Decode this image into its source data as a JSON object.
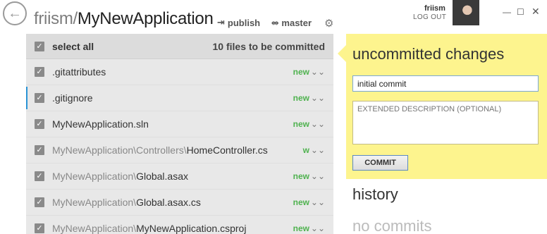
{
  "header": {
    "owner": "friism",
    "separator": "/",
    "repo": "MyNewApplication",
    "publish_label": "publish",
    "branch_label": "master",
    "user_name": "friism",
    "logout_label": "LOG OUT"
  },
  "file_list": {
    "select_all_label": "select all",
    "count_label": "10 files to be committed",
    "files": [
      {
        "dir": "",
        "name": ".gitattributes",
        "status": "new"
      },
      {
        "dir": "",
        "name": ".gitignore",
        "status": "new"
      },
      {
        "dir": "",
        "name": "MyNewApplication.sln",
        "status": "new"
      },
      {
        "dir": "MyNewApplication\\Controllers\\",
        "name": "HomeController.cs",
        "status": "w"
      },
      {
        "dir": "MyNewApplication\\",
        "name": "Global.asax",
        "status": "new"
      },
      {
        "dir": "MyNewApplication\\",
        "name": "Global.asax.cs",
        "status": "new"
      },
      {
        "dir": "MyNewApplication\\",
        "name": "MyNewApplication.csproj",
        "status": "new"
      }
    ]
  },
  "commit": {
    "title": "uncommitted changes",
    "summary_value": "initial commit",
    "description_placeholder": "EXTENDED DESCRIPTION (OPTIONAL)",
    "commit_label": "COMMIT"
  },
  "history": {
    "title": "history",
    "empty_label": "no commits"
  },
  "colors": {
    "accent_blue": "#2a93d5",
    "status_green": "#4fb24f",
    "commit_panel": "#fdf48e"
  }
}
